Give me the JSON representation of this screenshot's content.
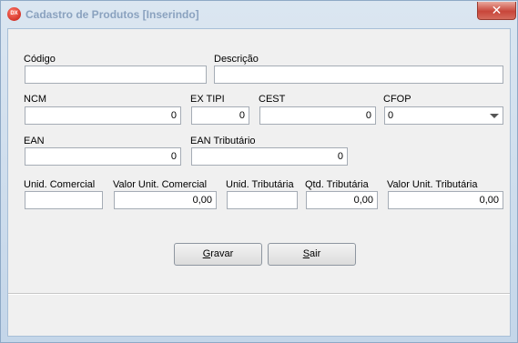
{
  "window": {
    "title": "Cadastro de Produtos [Inserindo]",
    "icon_text": "DX",
    "close_glyph": "✕"
  },
  "form": {
    "codigo": {
      "label": "Código",
      "value": ""
    },
    "descricao": {
      "label": "Descrição",
      "value": ""
    },
    "ncm": {
      "label": "NCM",
      "value": "0"
    },
    "ex_tipi": {
      "label": "EX TIPI",
      "value": "0"
    },
    "cest": {
      "label": "CEST",
      "value": "0"
    },
    "cfop": {
      "label": "CFOP",
      "value": "0"
    },
    "ean": {
      "label": "EAN",
      "value": "0"
    },
    "ean_tributario": {
      "label": "EAN Tributário",
      "value": "0"
    },
    "unid_comercial": {
      "label": "Unid. Comercial",
      "value": ""
    },
    "valor_unit_comercial": {
      "label": "Valor Unit. Comercial",
      "value": "0,00"
    },
    "unid_tributaria": {
      "label": "Unid. Tributária",
      "value": ""
    },
    "qtd_tributaria": {
      "label": "Qtd. Tributária",
      "value": "0,00"
    },
    "valor_unit_tributaria": {
      "label": "Valor Unit. Tributária",
      "value": "0,00"
    }
  },
  "buttons": {
    "gravar": {
      "mnemonic": "G",
      "rest": "ravar"
    },
    "sair": {
      "mnemonic": "S",
      "rest": "air"
    }
  },
  "colors": {
    "frame": "#c7d9ea",
    "client": "#f0f0f0",
    "title_text": "#8aa2bf",
    "close_button": "#c8463a"
  }
}
